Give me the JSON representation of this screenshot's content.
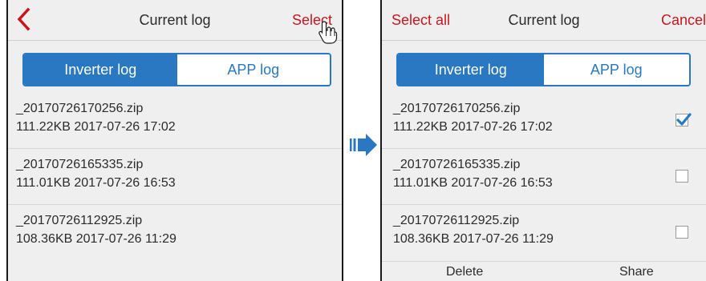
{
  "left_screen": {
    "header": {
      "title": "Current log",
      "select_label": "Select"
    },
    "tabs": [
      {
        "label": "Inverter log"
      },
      {
        "label": "APP log"
      }
    ],
    "files": [
      {
        "name": "_20170726170256.zip",
        "meta": "111.22KB 2017-07-26 17:02"
      },
      {
        "name": "_20170726165335.zip",
        "meta": "111.01KB 2017-07-26 16:53"
      },
      {
        "name": "_20170726112925.zip",
        "meta": "108.36KB 2017-07-26 11:29"
      }
    ]
  },
  "right_screen": {
    "header": {
      "select_all_label": "Select all",
      "title": "Current log",
      "cancel_label": "Cancel"
    },
    "tabs": [
      {
        "label": "Inverter log"
      },
      {
        "label": "APP log"
      }
    ],
    "files": [
      {
        "name": "_20170726170256.zip",
        "meta": "111.22KB 2017-07-26 17:02",
        "checked": true
      },
      {
        "name": "_20170726165335.zip",
        "meta": "111.01KB 2017-07-26 16:53",
        "checked": false
      },
      {
        "name": "_20170726112925.zip",
        "meta": "108.36KB 2017-07-26 11:29",
        "checked": false
      }
    ],
    "bottom_bar": {
      "delete_label": "Delete",
      "share_label": "Share"
    }
  },
  "colors": {
    "accent": "#c8161d",
    "tab_blue": "#2a78c2",
    "background": "#efefef"
  },
  "icons": {
    "back": "chevron-left-icon",
    "cursor": "hand-pointer-icon",
    "check": "checkmark-icon",
    "arrow": "right-arrow-icon"
  }
}
